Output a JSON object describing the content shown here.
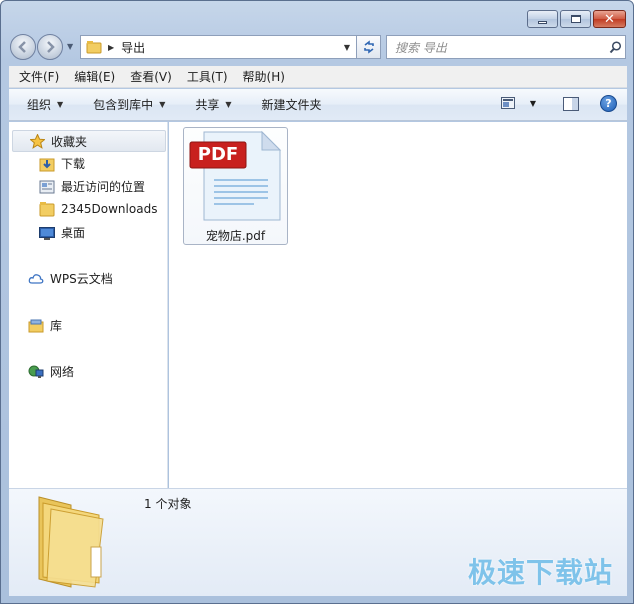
{
  "window": {
    "caption_buttons": [
      "minimize",
      "maximize",
      "close"
    ]
  },
  "nav": {
    "address_path": "导出",
    "search_placeholder": "搜索 导出"
  },
  "menubar": [
    {
      "label": "文件(F)"
    },
    {
      "label": "编辑(E)"
    },
    {
      "label": "查看(V)"
    },
    {
      "label": "工具(T)"
    },
    {
      "label": "帮助(H)"
    }
  ],
  "toolbar": {
    "organize": "组织",
    "include_in_library": "包含到库中",
    "share": "共享",
    "new_folder": "新建文件夹"
  },
  "sidebar": {
    "favorites": "收藏夹",
    "favorites_items": [
      {
        "label": "下载",
        "icon": "download-folder-icon"
      },
      {
        "label": "最近访问的位置",
        "icon": "recent-places-icon"
      },
      {
        "label": "2345Downloads",
        "icon": "folder-icon"
      },
      {
        "label": "桌面",
        "icon": "desktop-icon"
      }
    ],
    "wps": "WPS云文档",
    "libraries": "库",
    "network": "网络"
  },
  "files": [
    {
      "name": "宠物店.pdf",
      "badge": "PDF",
      "icon": "pdf-file-icon"
    }
  ],
  "details": {
    "count": "1 个对象"
  },
  "watermark": "极速下载站",
  "colors": {
    "pdf_badge": "#c8201e",
    "watermark": "#7fc3ea",
    "window_frame": "#b4c8e2"
  }
}
